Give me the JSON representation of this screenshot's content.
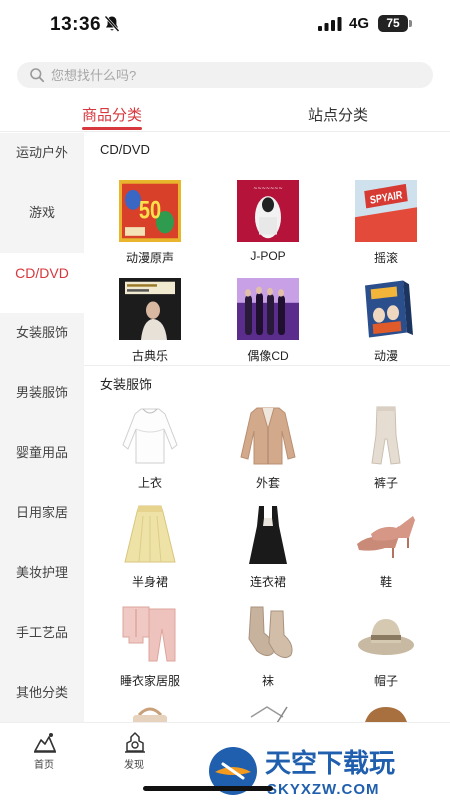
{
  "status_bar": {
    "time": "13:36",
    "network": "4G",
    "battery": "75"
  },
  "search": {
    "placeholder": "您想找什么吗?"
  },
  "top_tabs": [
    {
      "label": "商品分类",
      "active": true
    },
    {
      "label": "站点分类",
      "active": false
    }
  ],
  "sidebar": {
    "items": [
      {
        "label": "运动户外"
      },
      {
        "label": "游戏"
      },
      {
        "label": "CD/DVD",
        "active": true
      },
      {
        "label": "女装服饰"
      },
      {
        "label": "男装服饰"
      },
      {
        "label": "婴童用品"
      },
      {
        "label": "日用家居"
      },
      {
        "label": "美妆护理"
      },
      {
        "label": "手工艺品"
      },
      {
        "label": "其他分类"
      }
    ]
  },
  "sections": [
    {
      "title": "CD/DVD",
      "items": [
        {
          "label": "动漫原声",
          "icon": "anime-soundtrack-cover"
        },
        {
          "label": "J-POP",
          "icon": "jpop-cover"
        },
        {
          "label": "摇滚",
          "icon": "rock-cover"
        },
        {
          "label": "古典乐",
          "icon": "classical-cover"
        },
        {
          "label": "偶像CD",
          "icon": "idol-cd-cover"
        },
        {
          "label": "动漫",
          "icon": "anime-dvd-box"
        }
      ]
    },
    {
      "title": "女装服饰",
      "items": [
        {
          "label": "上衣",
          "icon": "blouse-image"
        },
        {
          "label": "外套",
          "icon": "coat-image"
        },
        {
          "label": "裤子",
          "icon": "pants-image"
        },
        {
          "label": "半身裙",
          "icon": "skirt-image"
        },
        {
          "label": "连衣裙",
          "icon": "dress-image"
        },
        {
          "label": "鞋",
          "icon": "shoes-image"
        },
        {
          "label": "睡衣家居服",
          "icon": "pajamas-image"
        },
        {
          "label": "袜",
          "icon": "socks-image"
        },
        {
          "label": "帽子",
          "icon": "hat-image"
        }
      ]
    }
  ],
  "bottom_nav": [
    {
      "label": "首页",
      "icon": "home-icon"
    },
    {
      "label": "发现",
      "icon": "discover-icon"
    }
  ],
  "watermark": {
    "title": "天空下载玩",
    "url": "SKYXZW.COM"
  },
  "colors": {
    "accent": "#d6383e",
    "sidebar_bg": "#f4f4f4",
    "search_bg": "#f1f1f1"
  }
}
